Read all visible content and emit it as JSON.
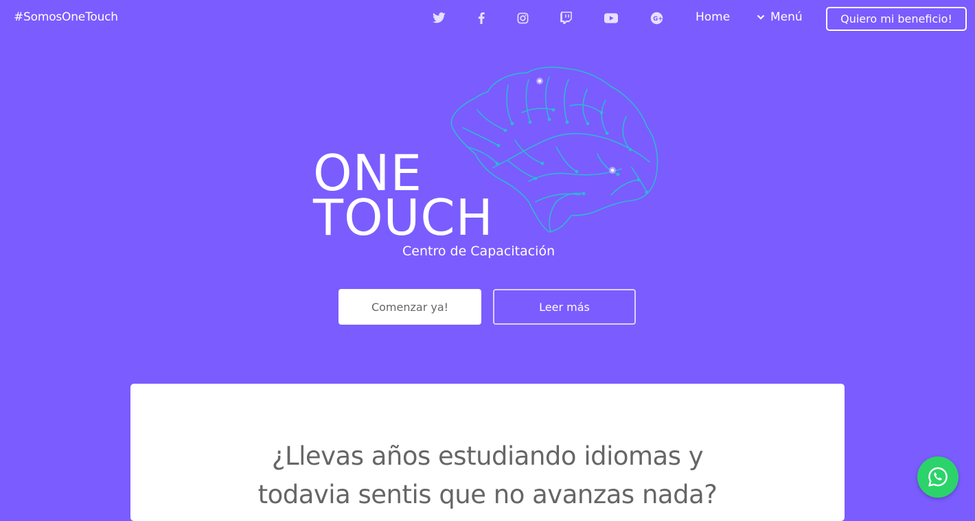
{
  "nav": {
    "hashtag": "#SomosOneTouch",
    "social": [
      {
        "name": "twitter-icon"
      },
      {
        "name": "facebook-icon"
      },
      {
        "name": "instagram-icon"
      },
      {
        "name": "twitch-icon"
      },
      {
        "name": "youtube-icon"
      },
      {
        "name": "google-plus-icon"
      }
    ],
    "home_label": "Home",
    "menu_label": "Menú",
    "cta_label": "Quiero mi beneficio!"
  },
  "hero": {
    "logo_line1": "ONE",
    "logo_line2": "TOUCH",
    "subtitle": "Centro de Capacitación",
    "primary_button": "Comenzar ya!",
    "secondary_button": "Leer más"
  },
  "card": {
    "title_line1": "¿Llevas años estudiando idiomas y",
    "title_line2": "todavia sentis que no avanzas nada?"
  },
  "colors": {
    "background": "#7b5cff",
    "brain_stroke": "#2fb6d6",
    "whatsapp": "#2bd36a"
  }
}
